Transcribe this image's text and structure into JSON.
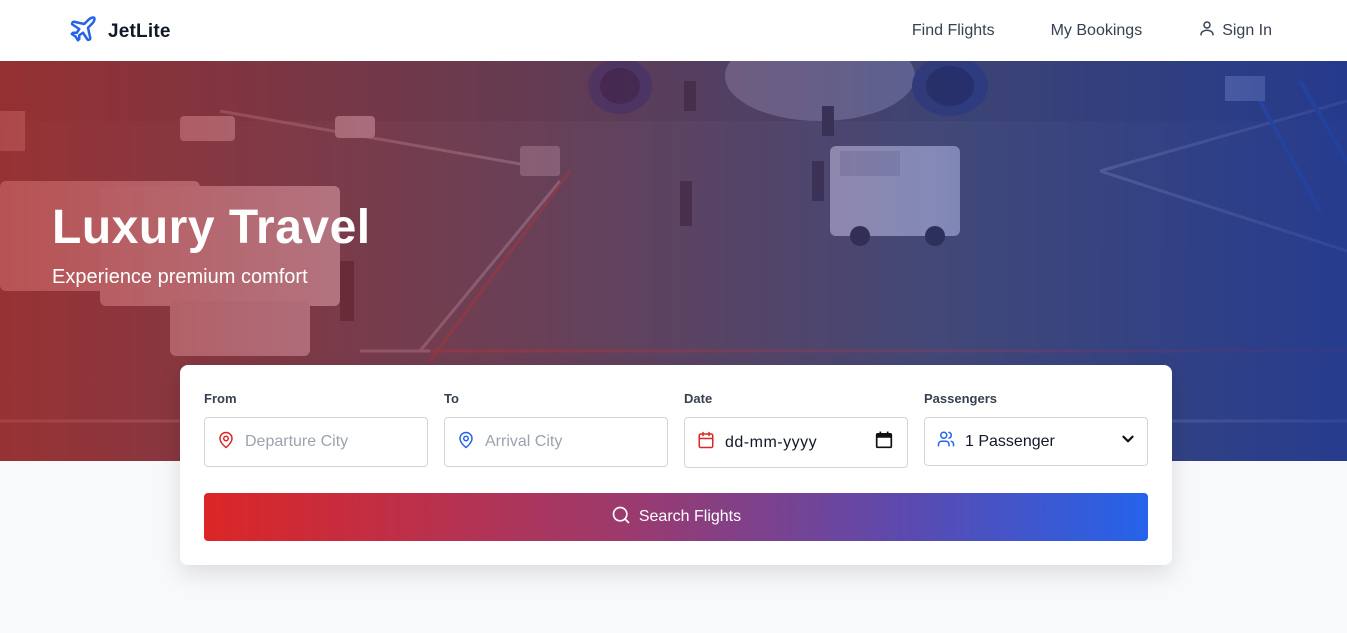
{
  "brand": {
    "name": "JetLite",
    "icon": "plane-icon",
    "color": "#2563eb"
  },
  "nav": {
    "find_flights": "Find Flights",
    "my_bookings": "My Bookings",
    "sign_in": "Sign In"
  },
  "hero": {
    "title": "Luxury Travel",
    "subtitle": "Experience premium comfort"
  },
  "search": {
    "from": {
      "label": "From",
      "placeholder": "Departure City",
      "icon": "map-pin-icon"
    },
    "to": {
      "label": "To",
      "placeholder": "Arrival City",
      "icon": "map-pin-icon"
    },
    "date": {
      "label": "Date",
      "value": "dd-mm-yyyy",
      "icon": "calendar-icon"
    },
    "passengers": {
      "label": "Passengers",
      "value": "1 Passenger",
      "icon": "users-icon"
    },
    "button_label": "Search Flights"
  },
  "colors": {
    "accent_red": "#dc2626",
    "accent_blue": "#2563eb"
  }
}
